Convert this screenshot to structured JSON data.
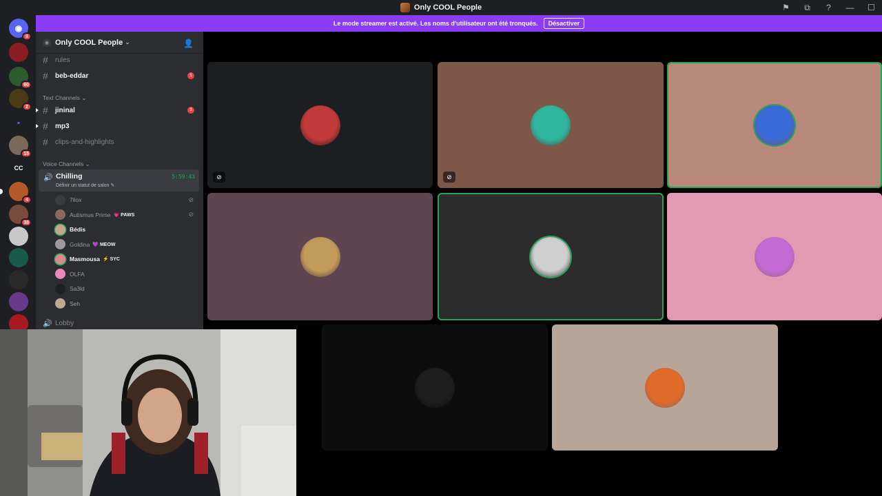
{
  "window": {
    "title": "Only COOL People",
    "buttons": [
      "⚑",
      "⧉",
      "?",
      "—",
      "☐"
    ]
  },
  "banner": {
    "message": "Le mode streamer est activé. Les noms d'utilisateur ont été tronqués.",
    "button_label": "Désactiver"
  },
  "guilds": [
    {
      "name": "discord-home",
      "color": "#5865f2",
      "badge": "8",
      "glyph": "◉"
    },
    {
      "name": "server-1",
      "color": "#8c1d22",
      "badge": "",
      "glyph": ""
    },
    {
      "name": "server-2",
      "color": "#2d5b2e",
      "badge": "60",
      "glyph": ""
    },
    {
      "name": "server-3",
      "color": "#4a3a15",
      "badge": "2",
      "glyph": ""
    },
    {
      "name": "folder",
      "color": "#1e1f22",
      "badge": "",
      "glyph": "▪"
    },
    {
      "name": "server-5",
      "color": "#7a6a5a",
      "badge": "15",
      "glyph": ""
    },
    {
      "name": "server-cc",
      "color": "#1e1f22",
      "badge": "",
      "glyph": "CC"
    },
    {
      "name": "server-only-cool",
      "color": "#b45a2a",
      "badge": "4",
      "glyph": ""
    },
    {
      "name": "server-8",
      "color": "#7a4a3a",
      "badge": "38",
      "glyph": ""
    },
    {
      "name": "server-9",
      "color": "#c8c8c8",
      "badge": "",
      "glyph": ""
    },
    {
      "name": "server-10",
      "color": "#1a5a4a",
      "badge": "",
      "glyph": ""
    },
    {
      "name": "server-11",
      "color": "#2a2a2a",
      "badge": "",
      "glyph": ""
    },
    {
      "name": "server-12",
      "color": "#6a3a8a",
      "badge": "",
      "glyph": ""
    },
    {
      "name": "server-13",
      "color": "#a81a22",
      "badge": "",
      "glyph": ""
    }
  ],
  "server": {
    "name": "Only COOL People",
    "channels_top": [
      {
        "name": "rules",
        "unread": false,
        "mention": ""
      },
      {
        "name": "beb-eddar",
        "unread": true,
        "mention": "1"
      }
    ],
    "text_category": "Text Channels",
    "text_channels": [
      {
        "name": "jininal",
        "unread": true,
        "mention": "3"
      },
      {
        "name": "mp3",
        "unread": true,
        "mention": ""
      },
      {
        "name": "clips-and-highlights",
        "unread": false,
        "mention": ""
      }
    ],
    "voice_category": "Voice Channels",
    "voice_channel": {
      "name": "Chilling",
      "timer": "5:59:43",
      "status": "Définir un statut de salon"
    },
    "voice_users": [
      {
        "name": "7llox",
        "tag": "",
        "active": false,
        "muted": true,
        "color": "#3a3c42"
      },
      {
        "name": "Autismus Prime",
        "tag": "💗 PAWS",
        "active": false,
        "muted": true,
        "color": "#8a6a5a"
      },
      {
        "name": "Bédis",
        "tag": "",
        "active": true,
        "muted": false,
        "color": "#c4a78a"
      },
      {
        "name": "Goldina",
        "tag": "💜 MEOW",
        "active": false,
        "muted": false,
        "color": "#9a9a9a"
      },
      {
        "name": "Masmousa",
        "tag": "⚡ SYC",
        "active": true,
        "muted": false,
        "color": "#d98a8a"
      },
      {
        "name": "OLFA",
        "tag": "",
        "active": false,
        "muted": false,
        "color": "#e88ab8"
      },
      {
        "name": "Sa3ld",
        "tag": "",
        "active": false,
        "muted": false,
        "color": "#1e1f22"
      },
      {
        "name": "Seh",
        "tag": "",
        "active": false,
        "muted": false,
        "color": "#c0a890"
      }
    ],
    "lobby": "Lobby"
  },
  "tiles": [
    {
      "name": "tile-1",
      "bg": "#1c1e21",
      "avatar": "#c23a3a",
      "muted": true,
      "speaking": false,
      "dim": false
    },
    {
      "name": "tile-2",
      "bg": "#7d5849",
      "avatar": "#2fb5a0",
      "muted": true,
      "speaking": false,
      "dim": false
    },
    {
      "name": "tile-3",
      "bg": "#b8897a",
      "avatar": "#3a6ad8",
      "muted": false,
      "speaking": true,
      "dim": false
    },
    {
      "name": "tile-4",
      "bg": "#5e4550",
      "avatar": "#c29a5a",
      "muted": false,
      "speaking": false,
      "dim": false
    },
    {
      "name": "tile-5",
      "bg": "#2c2c2c",
      "avatar": "#cfcfcf",
      "muted": false,
      "speaking": true,
      "dim": false
    },
    {
      "name": "tile-6",
      "bg": "#e19ab1",
      "avatar": "#c46ad6",
      "muted": false,
      "speaking": false,
      "dim": false
    },
    {
      "name": "tile-7",
      "bg": "#0d0d0d",
      "avatar": "#2a2a2a",
      "muted": false,
      "speaking": false,
      "dim": true
    },
    {
      "name": "tile-8",
      "bg": "#b7a698",
      "avatar": "#e06a2a",
      "muted": false,
      "speaking": false,
      "dim": false
    }
  ],
  "icons": {
    "speaker": "🔊",
    "mute": "🎙",
    "invite": "👤",
    "hash": "#"
  },
  "colors": {
    "accent": "#8a3cf7",
    "online": "#23a55a",
    "danger": "#f23f43"
  }
}
